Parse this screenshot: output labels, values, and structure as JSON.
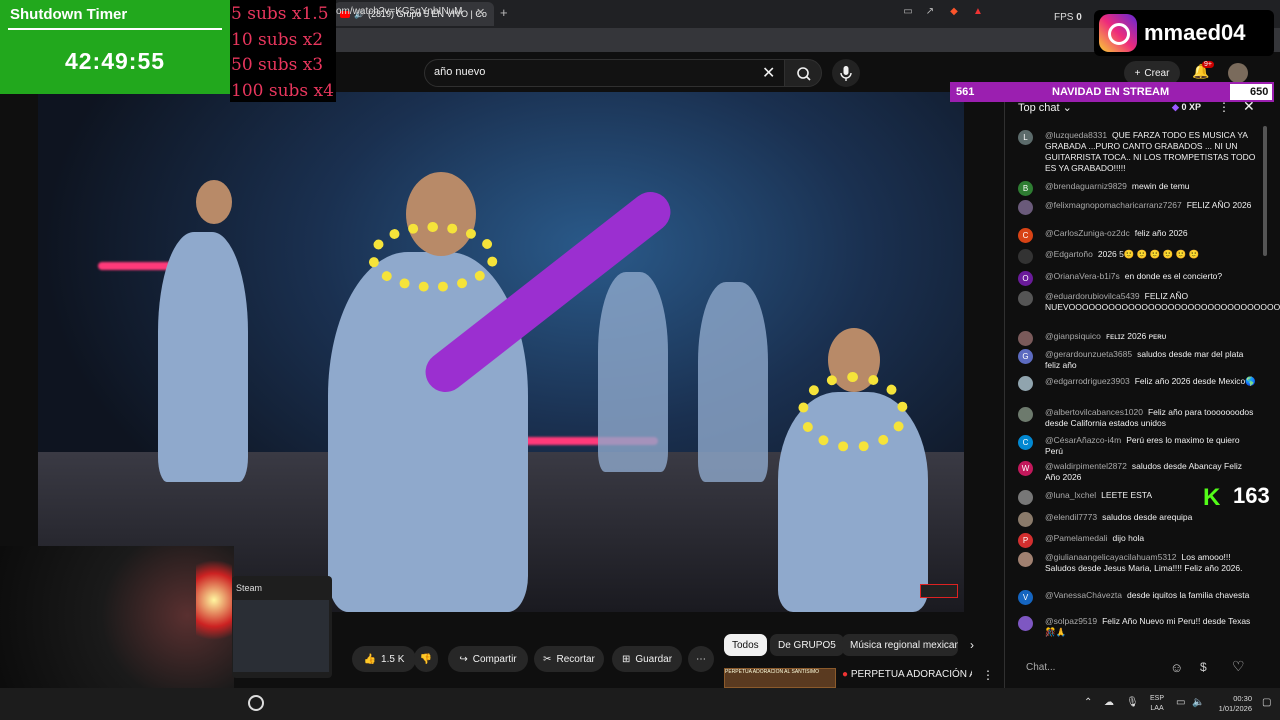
{
  "browser": {
    "tab_title": "(2819) Grupo 5 EN VIVO | Co",
    "url": "om/watch?v=KG5qYnbINuM",
    "fps_label": "FPS",
    "fps_value": "0"
  },
  "youtube": {
    "search_value": "año nuevo",
    "create_label": "Crear",
    "notification_badge": "9+"
  },
  "actions": {
    "likes": "1.5 K",
    "share": "Compartir",
    "clip": "Recortar",
    "save": "Guardar"
  },
  "chips": [
    "Todos",
    "De GRUPO5",
    "Música regional mexican"
  ],
  "recommendation": {
    "thumb_text": "PERPETUA ADORACIÓN AL SANTÍSIMO",
    "title": "PERPETUA ADORACIÓN AO SANTÍSSIMO COM FREIRAS"
  },
  "chat": {
    "title": "Top chat",
    "xp": "0 XP",
    "input_placeholder": "Chat...",
    "messages": [
      {
        "initial": "L",
        "color": "#5c6b6b",
        "author": "@luzqueda8331",
        "text": "QUE FARZA TODO ES MUSICA YA GRABADA ...PURO CANTO GRABADOS ... NI UN GUITARRISTA TOCA.. NI LOS TROMPETISTAS TODO ES YA GRABADO!!!!!"
      },
      {
        "initial": "B",
        "color": "#2e7d32",
        "author": "@brendaguarniz9829",
        "text": "mewin de temu"
      },
      {
        "initial": "",
        "color": "#6a5a7a",
        "author": "@felixmagnopomacharicarranz7267",
        "text": "FELIZ AÑO 2026"
      },
      {
        "initial": "C",
        "color": "#d84315",
        "author": "@CarlosZuniga-oz2dc",
        "text": "feliz año 2026"
      },
      {
        "initial": "",
        "color": "#333333",
        "author": "@Edgartoño",
        "text": "2026 5🙂 🙂 🙂 🙂 🙂 🙂"
      },
      {
        "initial": "O",
        "color": "#6a1b9a",
        "author": "@OrianaVera-b1i7s",
        "text": "en donde es el concierto?"
      },
      {
        "initial": "",
        "color": "#555555",
        "author": "@eduardorubiovilca5439",
        "text": "FELIZ AÑO NUEVOOOOOOOOOOOOOOOOOOOOOOOOOOOOOOOOOOO"
      },
      {
        "initial": "",
        "color": "#7a5a5a",
        "author": "@gianpsiquico",
        "text": "ꜰᴇʟɪᴢ 2026 ᴘᴇʀᴜ"
      },
      {
        "initial": "G",
        "color": "#5c6bc0",
        "author": "@gerardounzueta3685",
        "text": "saludos desde mar del plata feliz año"
      },
      {
        "initial": "",
        "color": "#90a4ae",
        "author": "@edgarrodriguez3903",
        "text": "Feliz año 2026 desde Mexico🌎"
      },
      {
        "initial": "",
        "color": "#6d7a6d",
        "author": "@albertovilcabances1020",
        "text": "Feliz año para tooooooodos desde California estados unidos"
      },
      {
        "initial": "C",
        "color": "#0288d1",
        "author": "@CésarAñazco-i4m",
        "text": "Perú eres lo maximo te quiero Perú"
      },
      {
        "initial": "W",
        "color": "#c2185b",
        "author": "@waldirpimentel2872",
        "text": "saludos desde Abancay Feliz Año 2026"
      },
      {
        "initial": "",
        "color": "#777777",
        "author": "@luna_lxchel",
        "text": "LEETE ESTA"
      },
      {
        "initial": "",
        "color": "#8a7a6a",
        "author": "@elendil7773",
        "text": "saludos desde arequipa"
      },
      {
        "initial": "P",
        "color": "#d32f2f",
        "author": "@Pamelamedali",
        "text": "dijo hola"
      },
      {
        "initial": "",
        "color": "#a08070",
        "author": "@giulianaangelicayacilahuam5312",
        "text": "Los amooo!!! Saludos desde Jesus Maria, Lima!!!! Feliz año 2026."
      },
      {
        "initial": "V",
        "color": "#1565c0",
        "author": "@VanessaChávezta",
        "text": "desde iquitos la familia chavesta"
      },
      {
        "initial": "",
        "color": "#7e57c2",
        "author": "@solpaz9519",
        "text": "Feliz Año Nuevo mi Peru!! desde Texas🎊🙏"
      }
    ]
  },
  "overlays": {
    "timer_title": "Shutdown Timer",
    "timer_value": "42:49:55",
    "subs_lines": [
      "5 subs x1.5",
      "10 subs x2",
      "50 subs x3",
      "100 subs x4"
    ],
    "instagram_handle": "mmaed04",
    "goal_current": "561",
    "goal_label": "NAVIDAD EN STREAM",
    "goal_target": "650",
    "goal_progress": 0.863,
    "kick_count": "163",
    "steam_label": "Steam"
  },
  "taskbar": {
    "lang_line1": "ESP",
    "lang_line2": "LAA",
    "time": "00:30",
    "date": "1/01/2026"
  }
}
